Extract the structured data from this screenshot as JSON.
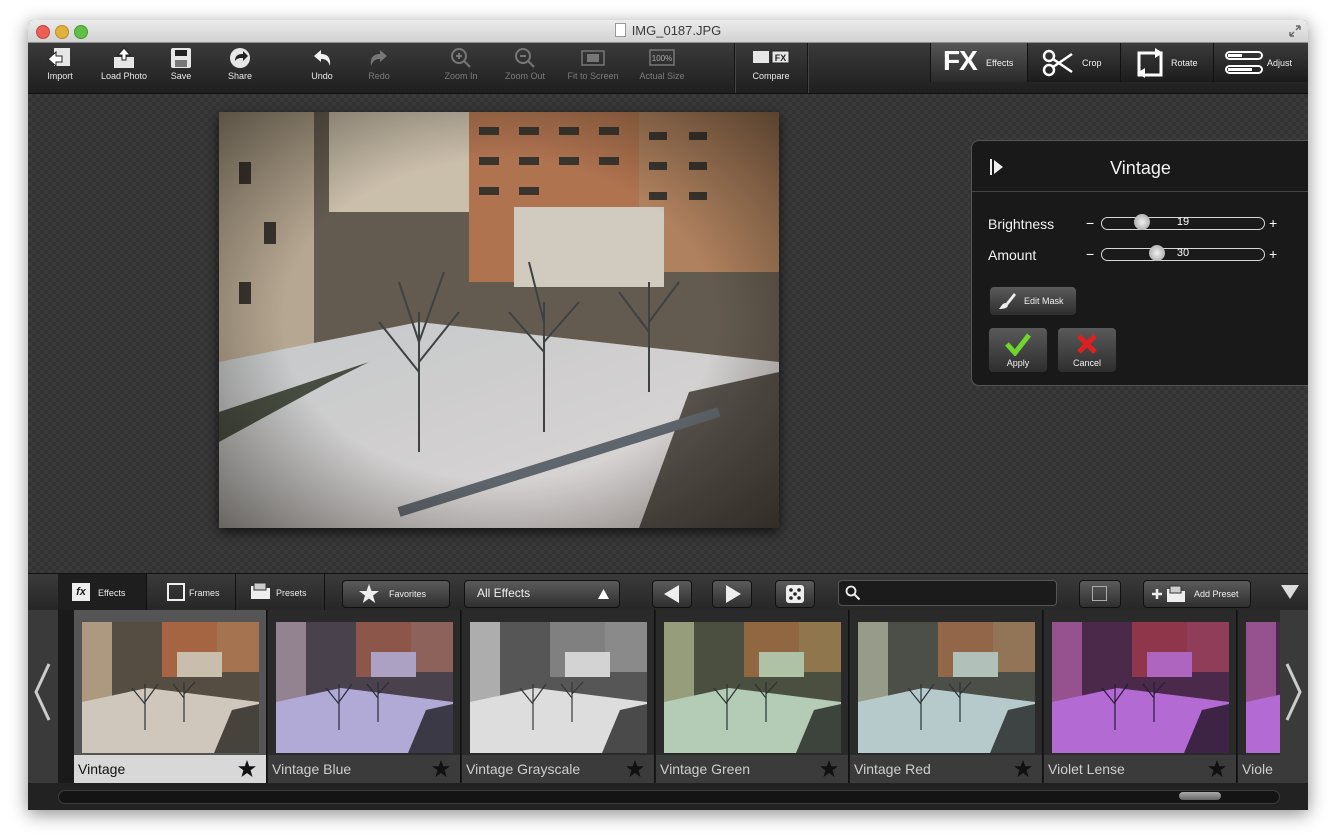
{
  "window": {
    "title": "IMG_0187.JPG"
  },
  "toolbar": {
    "import_label": "Import",
    "load_photo_label": "Load Photo",
    "save_label": "Save",
    "share_label": "Share",
    "undo_label": "Undo",
    "redo_label": "Redo",
    "zoom_in_label": "Zoom In",
    "zoom_out_label": "Zoom Out",
    "fit_to_screen_label": "Fit to Screen",
    "actual_size_label": "Actual Size",
    "actual_size_icon_text": "100%",
    "compare_label": "Compare",
    "compare_icon_text": "FX"
  },
  "modes": {
    "effects_label": "Effects",
    "effects_icon_text": "FX",
    "crop_label": "Crop",
    "rotate_label": "Rotate",
    "adjust_label": "Adjust"
  },
  "effect_panel": {
    "title": "Vintage",
    "brightness_label": "Brightness",
    "brightness_value": "19",
    "brightness_level": 0.22,
    "amount_label": "Amount",
    "amount_value": "30",
    "amount_level": 0.32,
    "minus_glyph": "−",
    "plus_glyph": "+",
    "edit_mask_label": "Edit Mask",
    "apply_label": "Apply",
    "cancel_label": "Cancel"
  },
  "strip_bar": {
    "effects_tab": "Effects",
    "effects_tab_icon_text": "fx",
    "frames_tab": "Frames",
    "presets_tab": "Presets",
    "favorites_label": "Favorites",
    "category_select": "All Effects",
    "search_placeholder": "",
    "add_preset_label": "Add Preset"
  },
  "thumbnails": [
    {
      "label": "Vintage",
      "selected": true
    },
    {
      "label": "Vintage Blue",
      "selected": false
    },
    {
      "label": "Vintage Grayscale",
      "selected": false
    },
    {
      "label": "Vintage Green",
      "selected": false
    },
    {
      "label": "Vintage Red",
      "selected": false
    },
    {
      "label": "Violet Lense",
      "selected": false
    },
    {
      "label": "Viole",
      "selected": false
    }
  ],
  "colors": {
    "apply_check": "#6fd62c",
    "cancel_x": "#e02020",
    "close_light": "#ec5f57",
    "minimize_light": "#e0b13b",
    "zoom_light": "#5fbf47"
  }
}
